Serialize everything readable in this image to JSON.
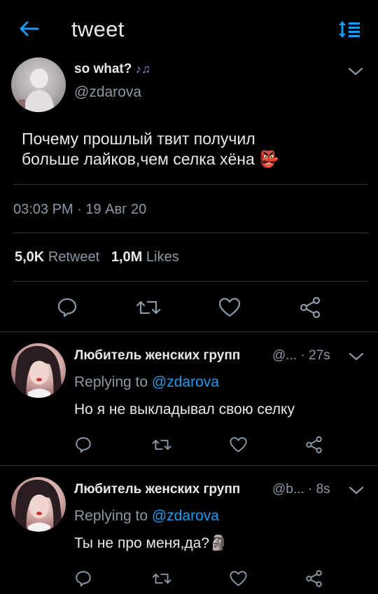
{
  "header": {
    "title": "tweet"
  },
  "main_tweet": {
    "display_name": "so what?",
    "name_emoji": "♪♫",
    "handle": "@zdarova",
    "text_line1": "Почему прошлый твит получил",
    "text_line2": "больше лайков,чем селка хёна",
    "text_emoji": "👺",
    "timestamp": "03:03 PM · 19 Авг 20",
    "retweets_count": "5,0K",
    "retweets_label": "Retweet",
    "likes_count": "1,0M",
    "likes_label": "Likes"
  },
  "replies": [
    {
      "display_name": "Любитель женских групп",
      "handle_trunc": "@...",
      "time": "· 27s",
      "replying_prefix": "Replying to",
      "replying_to": "@zdarova",
      "text": "Но я не выкладывал свою селку",
      "emoji": ""
    },
    {
      "display_name": "Любитель женских групп",
      "handle_trunc": "@b...",
      "time": "· 8s",
      "replying_prefix": "Replying to",
      "replying_to": "@zdarova",
      "text": "Ты не про меня,да?",
      "emoji": "🗿"
    }
  ],
  "colors": {
    "accent": "#1d9bf0",
    "muted": "#8b98a5",
    "divider": "#2f3336",
    "background": "#000000"
  },
  "icons": [
    "back-arrow-icon",
    "sort-icon",
    "chevron-down-icon",
    "reply-icon",
    "retweet-icon",
    "like-icon",
    "share-icon"
  ]
}
